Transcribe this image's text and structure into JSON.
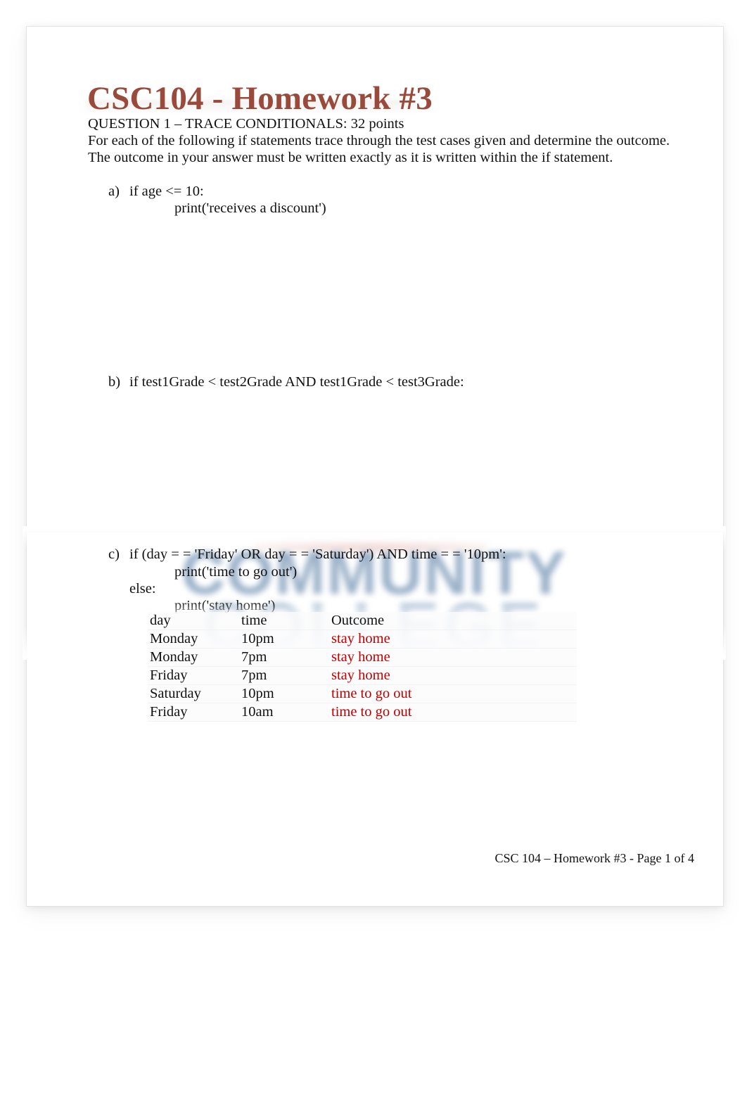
{
  "document": {
    "title": "CSC104 - Homework #3",
    "footer": "CSC 104 – Homework #3 - Page 1 of 4",
    "watermark": {
      "line1": "COMMUNITY",
      "line2": "COLLEGE"
    },
    "colors": {
      "title": "#9A4A3B",
      "body_text": "#111111",
      "outcome_red": "#C00000",
      "watermark_blue": "#5D82A8",
      "page_background": "#FFFFFF"
    }
  },
  "question": {
    "heading": "QUESTION 1 – TRACE CONDITIONALS: 32 points",
    "instruction_line_1": "For each of the following if statements trace through the test cases given and determine the outcome.",
    "instruction_line_2": "The outcome in your answer must be written exactly as it is written within the if statement."
  },
  "items": {
    "a": {
      "marker": "a)",
      "code_line_1": "if age <= 10:",
      "code_line_2": "print('receives a discount')"
    },
    "b": {
      "marker": "b)",
      "code_line_1": "if test1Grade < test2Grade AND test1Grade < test3Grade:"
    },
    "c": {
      "marker": "c)",
      "code_line_1": "if (day = = 'Friday' OR day = = 'Saturday') AND time = = '10pm':",
      "code_line_2": "print('time to go out')",
      "code_line_3": "else:",
      "code_line_4": "print('stay home')",
      "table": {
        "headers": [
          "day",
          "time",
          "Outcome"
        ],
        "rows": [
          [
            "Monday",
            "10pm",
            "stay home"
          ],
          [
            "Monday",
            "7pm",
            "stay home"
          ],
          [
            "Friday",
            "7pm",
            "stay home"
          ],
          [
            "Saturday",
            "10pm",
            "time to go out"
          ],
          [
            "Friday",
            "10am",
            "time to go out"
          ]
        ]
      }
    }
  }
}
